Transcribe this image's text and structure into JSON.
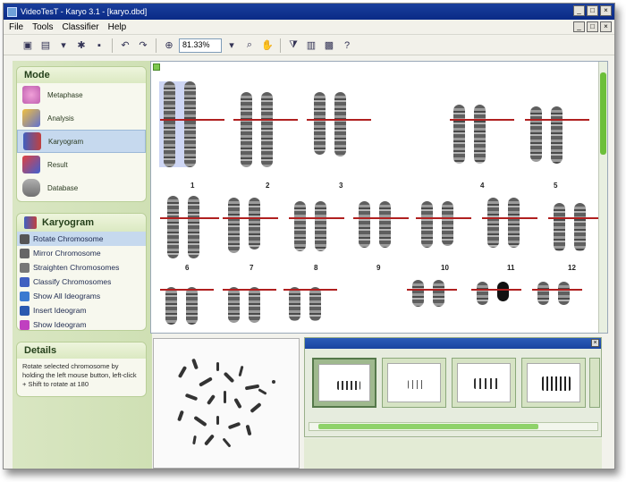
{
  "window": {
    "title": "VideoTesT - Karyo 3.1 - [karyo.dbd]"
  },
  "menu": [
    "File",
    "Tools",
    "Classifier",
    "Help"
  ],
  "toolbar": {
    "zoom_value": "81.33%"
  },
  "mode_panel": {
    "title": "Mode",
    "items": [
      {
        "label": "Metaphase",
        "icon": "metaphase-icon"
      },
      {
        "label": "Analysis",
        "icon": "analysis-icon"
      },
      {
        "label": "Karyogram",
        "icon": "karyogram-icon",
        "selected": true
      },
      {
        "label": "Result",
        "icon": "result-icon"
      },
      {
        "label": "Database",
        "icon": "database-icon"
      }
    ]
  },
  "karyogram_panel": {
    "title": "Karyogram",
    "items": [
      {
        "label": "Rotate Chromosome",
        "selected": true
      },
      {
        "label": "Mirror Chromosome"
      },
      {
        "label": "Straighten Chromosomes"
      },
      {
        "label": "Classify Chromosomes"
      },
      {
        "label": "Show All Ideograms"
      },
      {
        "label": "Insert Ideogram"
      },
      {
        "label": "Show Ideogram"
      }
    ]
  },
  "details_panel": {
    "title": "Details",
    "text": "Rotate selected chromosome by holding the left mouse button, left-click + Shift to rotate at 180"
  },
  "karyogram": {
    "labels": [
      "1",
      "2",
      "3",
      "4",
      "5",
      "6",
      "7",
      "8",
      "9",
      "10",
      "11",
      "12"
    ]
  },
  "colors": {
    "accent_green": "#6cbf3a",
    "centromere_line": "#b02020",
    "title_blue": "#0a2a86"
  }
}
